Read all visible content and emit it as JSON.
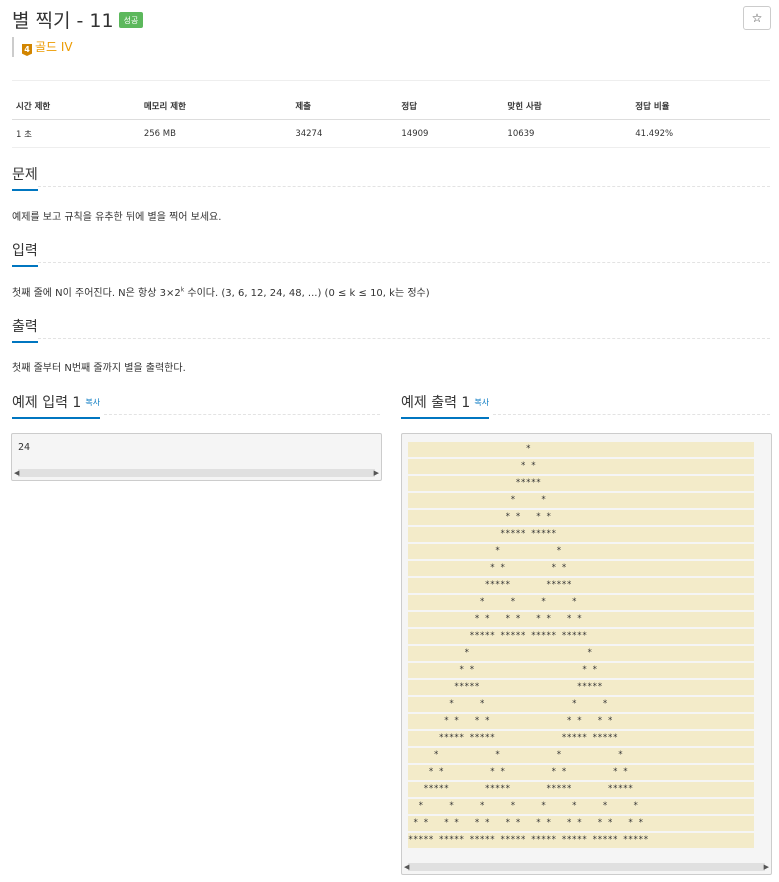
{
  "header": {
    "title": "별 찍기 - 11",
    "status_badge": "성공",
    "star_label": "☆",
    "tier_number": "4",
    "tier_label": "골드 IV"
  },
  "info_table": {
    "headers": [
      "시간 제한",
      "메모리 제한",
      "제출",
      "정답",
      "맞힌 사람",
      "정답 비율"
    ],
    "values": [
      "1 초",
      "256 MB",
      "34274",
      "14909",
      "10639",
      "41.492%"
    ]
  },
  "sections": {
    "problem_title": "문제",
    "problem_text": "예제를 보고 규칙을 유추한 뒤에 별을 찍어 보세요.",
    "input_title": "입력",
    "input_text_before": "첫째 줄에 N이 주어진다. N은 항상 3×2",
    "input_text_sup": "k",
    "input_text_after": " 수이다. (3, 6, 12, 24, 48, ...) (0 ≤ k ≤ 10, k는 정수)",
    "output_title": "출력",
    "output_text": "첫째 줄부터 N번째 줄까지 별을 출력한다.",
    "sample_input_title": "예제 입력 1",
    "sample_output_title": "예제 출력 1",
    "copy_label": "복사"
  },
  "sample_input": "24",
  "sample_output": [
    "                       *                       ",
    "                      * *                      ",
    "                     *****                     ",
    "                    *     *                    ",
    "                   * *   * *                   ",
    "                  ***** *****                  ",
    "                 *           *                 ",
    "                * *         * *                ",
    "               *****       *****               ",
    "              *     *     *     *              ",
    "             * *   * *   * *   * *             ",
    "            ***** ***** ***** *****            ",
    "           *                       *           ",
    "          * *                     * *          ",
    "         *****                   *****         ",
    "        *     *                 *     *        ",
    "       * *   * *               * *   * *       ",
    "      ***** *****             ***** *****      ",
    "     *           *           *           *     ",
    "    * *         * *         * *         * *    ",
    "   *****       *****       *****       *****   ",
    "  *     *     *     *     *     *     *     *  ",
    " * *   * *   * *   * *   * *   * *   * *   * * ",
    "***** ***** ***** ***** ***** ***** ***** *****"
  ],
  "colors": {
    "accent": "#0076c0",
    "success": "#5cb85c",
    "tier": "#ec9a00",
    "highlight": "#f3ebc9"
  }
}
